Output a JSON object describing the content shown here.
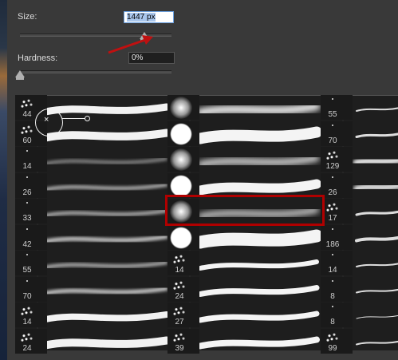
{
  "size": {
    "label": "Size:",
    "value": "1447 px",
    "level": 0.82
  },
  "hardness": {
    "label": "Hardness:",
    "value": "0%",
    "level": 0.0
  },
  "brushes": {
    "col1": [
      "44",
      "60",
      "14",
      "26",
      "33",
      "42",
      "55",
      "70",
      "14",
      "24"
    ],
    "col2": [
      "",
      "",
      "",
      "",
      "",
      "",
      "14",
      "24",
      "27",
      "39"
    ],
    "col3": [
      "55",
      "70",
      "129",
      "26",
      "17",
      "186",
      "14",
      "8",
      "8",
      "99"
    ]
  },
  "colors": {
    "accent": "#b00000",
    "arrow": "#c01010",
    "panel": "#393939",
    "grid": "#1e1e1e"
  },
  "icons": {
    "cursor": "brush-cursor-icon",
    "arrow": "red-arrow-annotation"
  }
}
